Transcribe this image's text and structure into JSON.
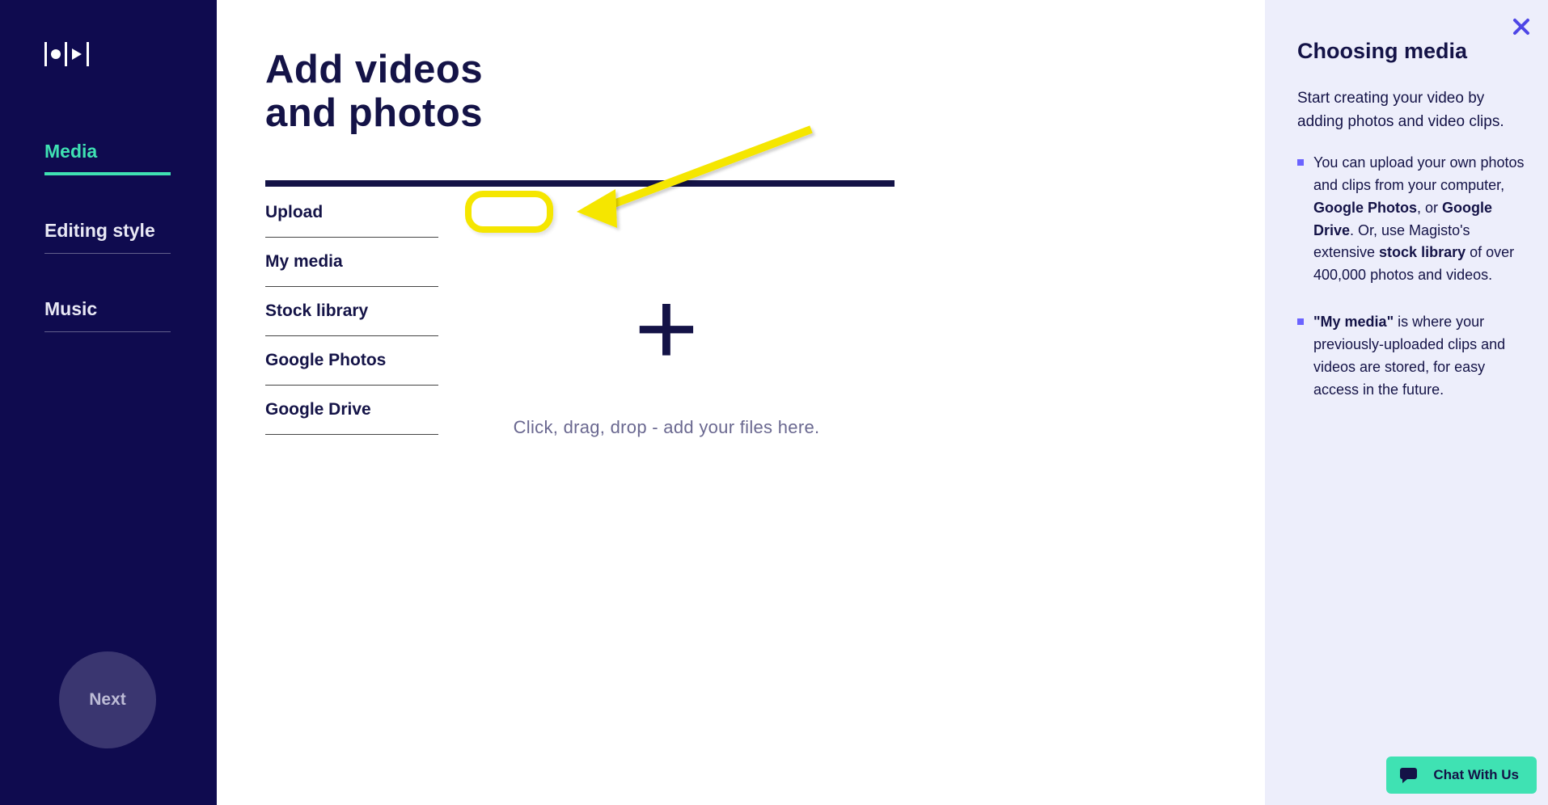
{
  "sidebar": {
    "nav": [
      {
        "label": "Media",
        "id": "media",
        "active": true
      },
      {
        "label": "Editing style",
        "id": "editing",
        "active": false
      },
      {
        "label": "Music",
        "id": "music",
        "active": false
      }
    ],
    "next_label": "Next"
  },
  "page": {
    "title_line1": "Add videos",
    "title_line2": "and photos"
  },
  "sources": [
    {
      "label": "Upload",
      "id": "upload",
      "highlighted": true
    },
    {
      "label": "My media",
      "id": "my-media",
      "highlighted": false
    },
    {
      "label": "Stock library",
      "id": "stock-library",
      "highlighted": false
    },
    {
      "label": "Google Photos",
      "id": "google-photos",
      "highlighted": false
    },
    {
      "label": "Google Drive",
      "id": "google-drive",
      "highlighted": false
    }
  ],
  "dropzone": {
    "hint": "Click, drag, drop - add your files here."
  },
  "help": {
    "title": "Choosing media",
    "intro": "Start creating your video by adding photos and video clips.",
    "bullet1": {
      "pre": "You can upload your own photos and clips from your computer, ",
      "b1": "Google Photos",
      "mid1": ", or ",
      "b2": "Google Drive",
      "mid2": ". Or, use Magisto's extensive ",
      "b3": "stock library",
      "post": " of over 400,000 photos and videos."
    },
    "bullet2": {
      "b1": "\"My media\"",
      "post": " is where your previously-uploaded clips and videos are stored, for easy access in the future."
    }
  },
  "chat": {
    "label": "Chat With Us"
  },
  "colors": {
    "navy": "#141347",
    "sidebar_bg": "#0f0b4f",
    "accent_teal": "#3fe2b3",
    "help_bg": "#edeefb",
    "highlight_yellow": "#f5e600",
    "link_purple": "#4e46e6"
  }
}
